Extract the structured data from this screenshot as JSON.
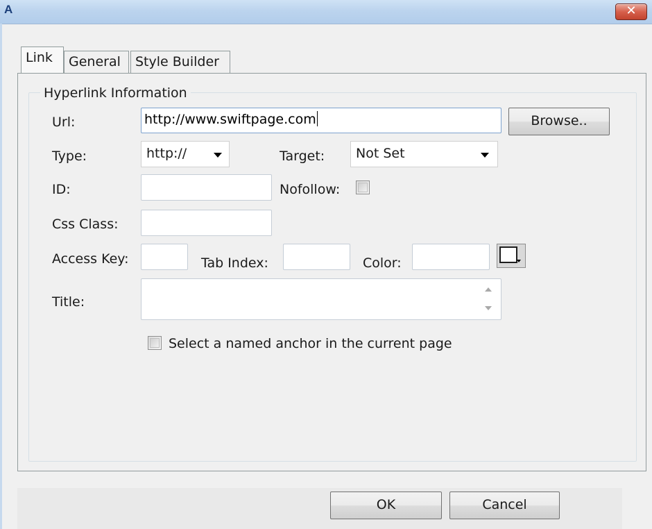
{
  "window": {
    "title": "A",
    "close_symbol": "✕"
  },
  "tabs": [
    {
      "label": "Link",
      "active": true
    },
    {
      "label": "General",
      "active": false
    },
    {
      "label": "Style Builder",
      "active": false
    }
  ],
  "group": {
    "legend": "Hyperlink Information"
  },
  "form": {
    "url_label": "Url:",
    "url_value": "http://www.swiftpage.com",
    "browse_label": "Browse..",
    "type_label": "Type:",
    "type_value": "http://",
    "target_label": "Target:",
    "target_value": "Not Set",
    "id_label": "ID:",
    "id_value": "",
    "nofollow_label": "Nofollow:",
    "nofollow_checked": false,
    "cssclass_label": "Css Class:",
    "cssclass_value": "",
    "accesskey_label": "Access Key:",
    "accesskey_value": "",
    "tabindex_label": "Tab Index:",
    "tabindex_value": "",
    "color_label": "Color:",
    "color_value": "",
    "title_label": "Title:",
    "title_value": "",
    "anchor_label": "Select a named anchor in the current page",
    "anchor_checked": false
  },
  "footer": {
    "ok_label": "OK",
    "cancel_label": "Cancel"
  },
  "icons": {
    "close": "close-icon",
    "dropdown_arrow": "chevron-down-icon",
    "scroll_up": "scroll-up-icon",
    "scroll_down": "scroll-down-icon",
    "color_picker": "color-swatch-icon"
  },
  "colors": {
    "titlebar": "#bcd4ee",
    "close_button": "#d7604c",
    "panel_border": "#919b9c",
    "focus_border": "#7da2ce"
  }
}
